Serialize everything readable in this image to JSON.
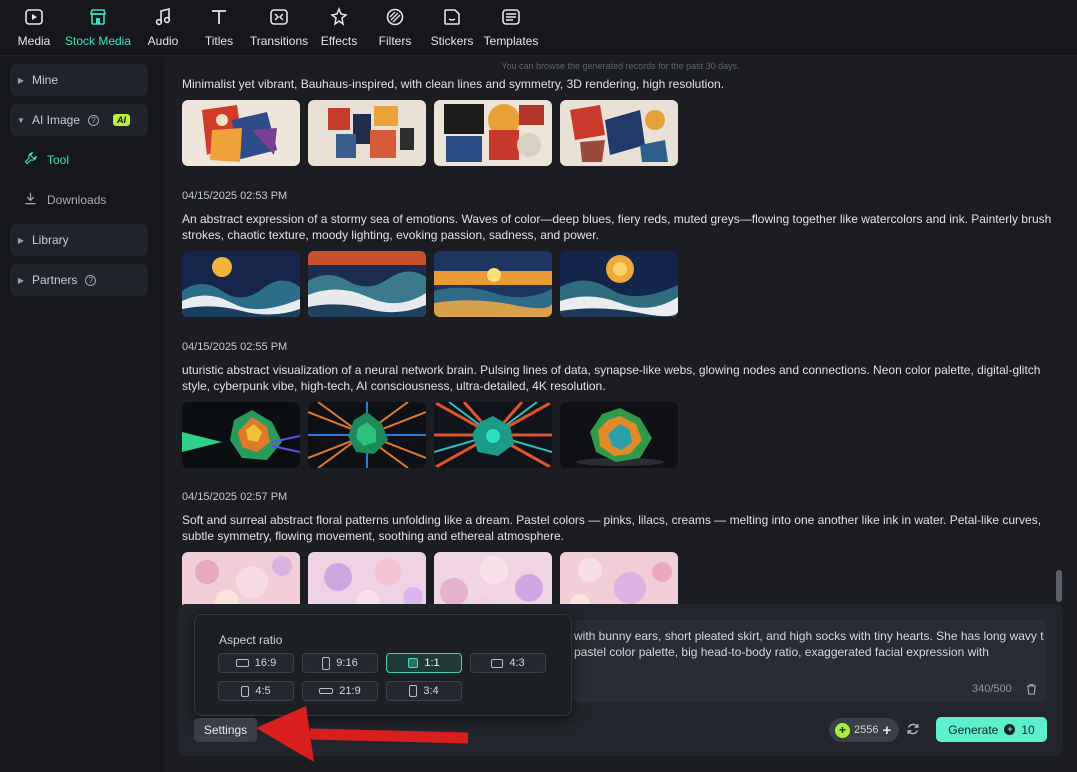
{
  "toolbar": {
    "items": [
      {
        "label": "Media",
        "icon": "media-icon"
      },
      {
        "label": "Stock Media",
        "icon": "stock-media-icon",
        "active": true
      },
      {
        "label": "Audio",
        "icon": "music-note-icon"
      },
      {
        "label": "Titles",
        "icon": "titles-icon"
      },
      {
        "label": "Transitions",
        "icon": "transitions-icon"
      },
      {
        "label": "Effects",
        "icon": "effects-icon"
      },
      {
        "label": "Filters",
        "icon": "filters-icon"
      },
      {
        "label": "Stickers",
        "icon": "stickers-icon"
      },
      {
        "label": "Templates",
        "icon": "templates-icon"
      }
    ],
    "accent": "#3fe0c0"
  },
  "sidebar": {
    "mine": "Mine",
    "ai_image": "AI Image",
    "ai_badge": "AI",
    "help_glyph": "?",
    "tool": "Tool",
    "downloads": "Downloads",
    "library": "Library",
    "partners": "Partners"
  },
  "main": {
    "hint": "You can browse the generated records for the past 30 days.",
    "records": [
      {
        "date": "",
        "prompt": "Minimalist yet vibrant, Bauhaus-inspired, with clean lines and symmetry, 3D rendering, high resolution."
      },
      {
        "date": "04/15/2025 02:53 PM",
        "prompt": "An abstract expression of a stormy sea of emotions. Waves of color—deep blues, fiery reds, muted greys—flowing together like watercolors and ink. Painterly brush strokes, chaotic texture, moody lighting, evoking passion, sadness, and power."
      },
      {
        "date": "04/15/2025 02:55 PM",
        "prompt": "uturistic abstract visualization of a neural network brain. Pulsing lines of data, synapse-like webs, glowing nodes and connections. Neon color palette, digital-glitch style, cyberpunk vibe, high-tech, AI consciousness, ultra-detailed, 4K resolution."
      },
      {
        "date": "04/15/2025 02:57 PM",
        "prompt": "Soft and surreal abstract floral patterns unfolding like a dream. Pastel colors — pinks, lilacs, creams — melting into one another like ink in water. Petal-like curves, subtle symmetry, flowing movement, soothing and ethereal atmosphere."
      }
    ]
  },
  "prompt_box": {
    "text": "with bunny ears, short pleated skirt, and high socks with tiny hearts. She has long wavy t pastel color palette, big head-to-body ratio, exaggerated facial expression with",
    "counter": "340/500"
  },
  "aspect_ratio": {
    "title": "Aspect ratio",
    "options": [
      "16:9",
      "9:16",
      "1:1",
      "4:3",
      "4:5",
      "21:9",
      "3:4"
    ],
    "selected": "1:1"
  },
  "controls": {
    "settings": "Settings",
    "credits": "2556",
    "credit_plus": "+",
    "coin_glyph": "+",
    "generate": "Generate",
    "generate_cost": "10"
  }
}
